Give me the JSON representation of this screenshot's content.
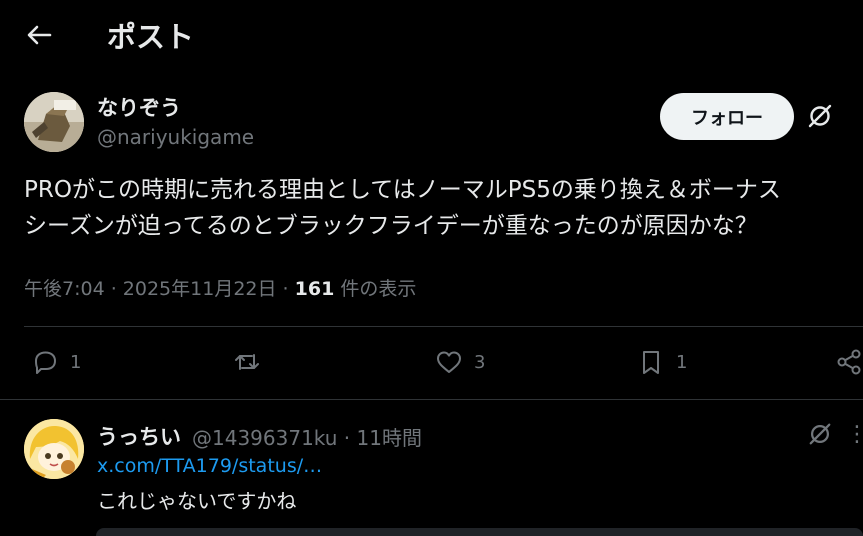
{
  "header": {
    "title": "ポスト"
  },
  "post": {
    "author_name": "なりぞう",
    "author_handle": "@nariyukigame",
    "follow_label": "フォロー",
    "text": "PROがこの時期に売れる理由としてはノーマルPS5の乗り換え＆ボーナス\nシーズンが迫ってるのとブラックフライデーが重なったのが原因かな？",
    "time": "午後7:04 · 2025年11月22日 · ",
    "views_count": "161",
    "views_label": " 件の表示",
    "replies": "1",
    "likes": "3",
    "bookmarks": "1"
  },
  "reply": {
    "name": "うっちい",
    "meta": "@14396371ku · 11時間",
    "link": "x.com/TTA179/status/…",
    "text": "これじゃないですかね",
    "more": "⋮"
  },
  "colors": {
    "background": "#000000",
    "text_primary": "#e7e9ea",
    "text_secondary": "#71767b",
    "link": "#1d9bf0",
    "divider": "#2f3336",
    "follow_bg": "#eff3f4"
  }
}
